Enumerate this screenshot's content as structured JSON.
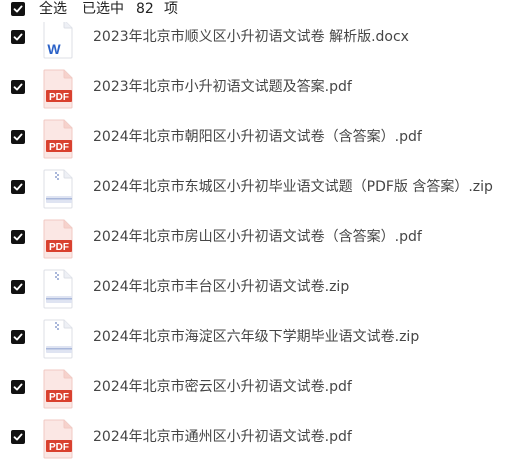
{
  "header": {
    "select_all_label": "全选",
    "selected_label": "已选中",
    "selected_count": "82",
    "unit_label": "项"
  },
  "files": [
    {
      "name": "2023年北京市顺义区小升初语文试卷 解析版.docx",
      "type": "docx",
      "icon": "word-file-icon",
      "badge": "W"
    },
    {
      "name": "2023年北京市小升初语文试题及答案.pdf",
      "type": "pdf",
      "icon": "pdf-file-icon",
      "badge": "PDF"
    },
    {
      "name": "2024年北京市朝阳区小升初语文试卷（含答案）.pdf",
      "type": "pdf",
      "icon": "pdf-file-icon",
      "badge": "PDF"
    },
    {
      "name": "2024年北京市东城区小升初毕业语文试题（PDF版 含答案）.zip",
      "type": "zip",
      "icon": "zip-file-icon",
      "badge": ""
    },
    {
      "name": "2024年北京市房山区小升初语文试卷（含答案）.pdf",
      "type": "pdf",
      "icon": "pdf-file-icon",
      "badge": "PDF"
    },
    {
      "name": "2024年北京市丰台区小升初语文试卷.zip",
      "type": "zip",
      "icon": "zip-file-icon",
      "badge": ""
    },
    {
      "name": "2024年北京市海淀区六年级下学期毕业语文试卷.zip",
      "type": "zip",
      "icon": "zip-file-icon",
      "badge": ""
    },
    {
      "name": "2024年北京市密云区小升初语文试卷.pdf",
      "type": "pdf",
      "icon": "pdf-file-icon",
      "badge": "PDF"
    },
    {
      "name": "2024年北京市通州区小升初语文试卷.pdf",
      "type": "pdf",
      "icon": "pdf-file-icon",
      "badge": "PDF"
    }
  ],
  "colors": {
    "checkbox": "#111111",
    "pdf_red": "#d9412f",
    "word_blue": "#2b62c8",
    "zip_blue": "#a9b7da",
    "text": "#454545"
  }
}
